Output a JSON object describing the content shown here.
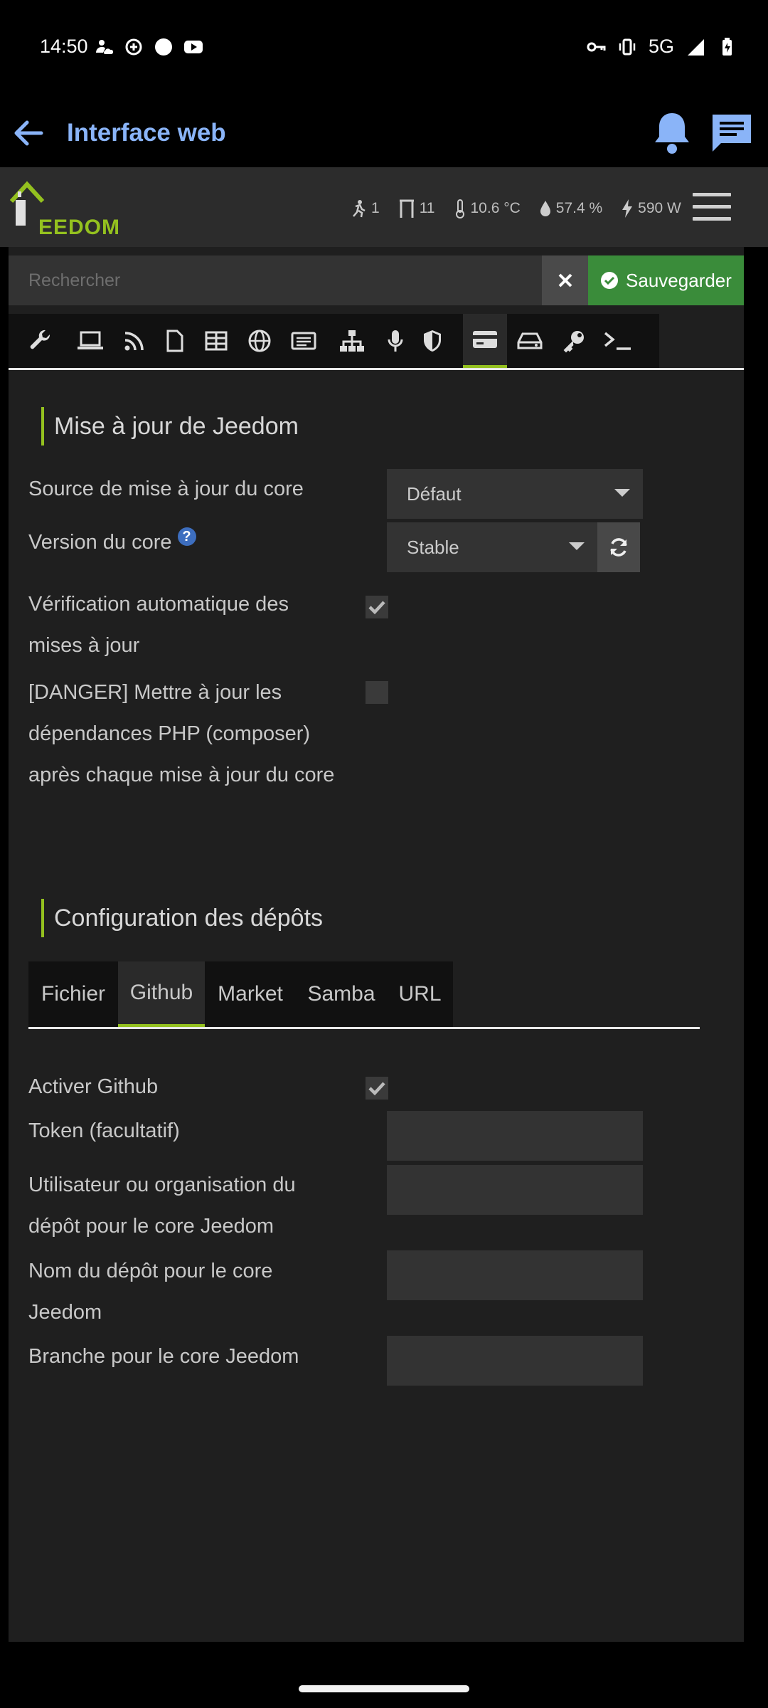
{
  "status_bar": {
    "time": "14:50",
    "network": "5G"
  },
  "app_bar": {
    "title": "Interface web"
  },
  "header": {
    "logo_text": "EEDOM",
    "summary": {
      "motion": "1",
      "openings": "11",
      "temperature": "10.6 °C",
      "humidity": "57.4 %",
      "power": "590 W"
    }
  },
  "toolbar": {
    "search_placeholder": "Rechercher",
    "save_label": "Sauvegarder"
  },
  "tabs": [
    "wrench",
    "laptop",
    "rss",
    "file",
    "table",
    "dns",
    "news",
    "network",
    "microphone",
    "shield",
    "credit-card",
    "drive",
    "key",
    "terminal"
  ],
  "update_section": {
    "title": "Mise à jour de Jeedom",
    "source_label": "Source de mise à jour du core",
    "source_value": "Défaut",
    "version_label": "Version du core",
    "version_help": "?",
    "version_value": "Stable",
    "auto_check_label": "Vérification automatique des mises à jour",
    "auto_check_checked": true,
    "danger_label": "[DANGER] Mettre à jour les dépendances PHP (composer) après chaque mise à jour du core",
    "danger_checked": false
  },
  "repos_section": {
    "title": "Configuration des dépôts",
    "tabs": [
      "Fichier",
      "Github",
      "Market",
      "Samba",
      "URL"
    ],
    "active_tab": "Github",
    "github": {
      "enable_label": "Activer Github",
      "enabled": true,
      "token_label": "Token (facultatif)",
      "token_value": "",
      "user_label": "Utilisateur ou organisation du dépôt pour le core Jeedom",
      "user_value": "",
      "repo_label": "Nom du dépôt pour le core Jeedom",
      "repo_value": "",
      "branch_label": "Branche pour le core Jeedom",
      "branch_value": ""
    }
  },
  "colors": {
    "accent": "#94c11f",
    "save": "#3a8c3a",
    "link": "#8ab4f8",
    "background": "#1f1f1f"
  }
}
